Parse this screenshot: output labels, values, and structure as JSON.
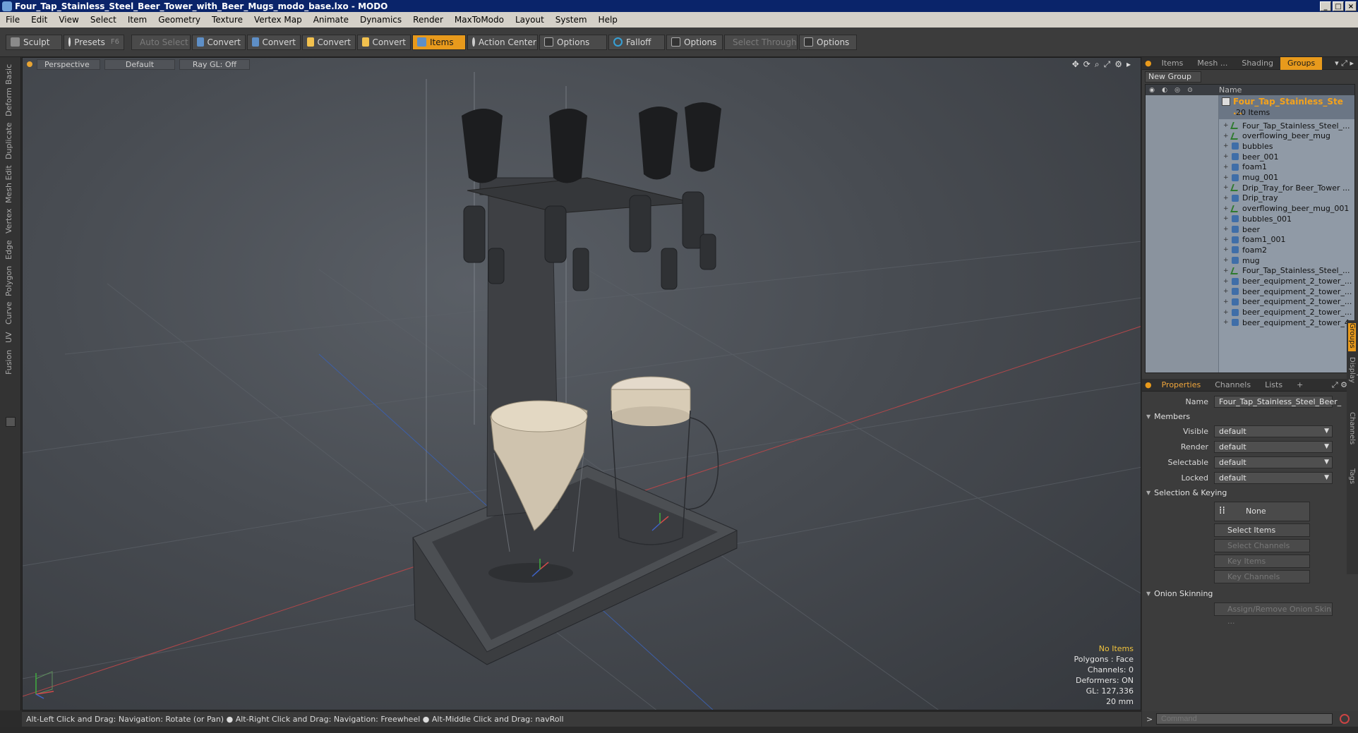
{
  "window": {
    "title": "Four_Tap_Stainless_Steel_Beer_Tower_with_Beer_Mugs_modo_base.lxo - MODO"
  },
  "menu": [
    "File",
    "Edit",
    "View",
    "Select",
    "Item",
    "Geometry",
    "Texture",
    "Vertex Map",
    "Animate",
    "Dynamics",
    "Render",
    "MaxToModo",
    "Layout",
    "System",
    "Help"
  ],
  "toolbar": {
    "sculpt": "Sculpt",
    "presets": "Presets",
    "presets_shortcut": "F6",
    "auto_select": "Auto Select",
    "convert1": "Convert",
    "convert2": "Convert",
    "convert3": "Convert",
    "convert4": "Convert",
    "items": "Items",
    "action_center": "Action Center",
    "options1": "Options",
    "falloff": "Falloff",
    "options2": "Options",
    "select_through": "Select Through",
    "options3": "Options"
  },
  "left_tabs": [
    "Basic",
    "Deform",
    "Duplicate",
    "Mesh Edit",
    "Vertex",
    "Edge",
    "Polygon",
    "Curve",
    "UV",
    "Fusion"
  ],
  "viewport": {
    "view": "Perspective",
    "shading": "Default",
    "raygl": "Ray GL: Off",
    "info": {
      "no_items": "No Items",
      "polygons": "Polygons : Face",
      "channels": "Channels: 0",
      "deformers": "Deformers: ON",
      "gl": "GL: 127,336",
      "scale": "20 mm"
    }
  },
  "status_bar": "Alt-Left Click and Drag: Navigation: Rotate (or Pan) ●  Alt-Right Click and Drag: Navigation: Freewheel ●  Alt-Middle Click and Drag: navRoll",
  "right_panel": {
    "top_tabs": [
      "Items",
      "Mesh ...",
      "Shading",
      "Groups"
    ],
    "new_group": "New Group",
    "name_col": "Name",
    "group": {
      "name": "Four_Tap_Stainless_Ste ...",
      "count": "20 Items"
    },
    "items": [
      {
        "name": "Four_Tap_Stainless_Steel_...",
        "type": "locator"
      },
      {
        "name": "overflowing_beer_mug",
        "type": "locator"
      },
      {
        "name": "bubbles",
        "type": "mesh"
      },
      {
        "name": "beer_001",
        "type": "mesh"
      },
      {
        "name": "foam1",
        "type": "mesh"
      },
      {
        "name": "mug_001",
        "type": "mesh"
      },
      {
        "name": "Drip_Tray_for Beer_Tower ...",
        "type": "locator"
      },
      {
        "name": "Drip_tray",
        "type": "mesh"
      },
      {
        "name": "overflowing_beer_mug_001",
        "type": "locator"
      },
      {
        "name": "bubbles_001",
        "type": "mesh"
      },
      {
        "name": "beer",
        "type": "mesh"
      },
      {
        "name": "foam1_001",
        "type": "mesh"
      },
      {
        "name": "foam2",
        "type": "mesh"
      },
      {
        "name": "mug",
        "type": "mesh"
      },
      {
        "name": "Four_Tap_Stainless_Steel_...",
        "type": "locator"
      },
      {
        "name": "beer_equipment_2_tower_...",
        "type": "mesh"
      },
      {
        "name": "beer_equipment_2_tower_...",
        "type": "mesh"
      },
      {
        "name": "beer_equipment_2_tower_...",
        "type": "mesh"
      },
      {
        "name": "beer_equipment_2_tower_...",
        "type": "mesh"
      },
      {
        "name": "beer_equipment_2_tower_4",
        "type": "mesh"
      }
    ],
    "prop_tabs": [
      "Properties",
      "Channels",
      "Lists",
      "+"
    ],
    "props": {
      "name_label": "Name",
      "name_value": "Four_Tap_Stainless_Steel_Beer_",
      "members": "Members",
      "visible_label": "Visible",
      "visible_value": "default",
      "render_label": "Render",
      "render_value": "default",
      "selectable_label": "Selectable",
      "selectable_value": "default",
      "locked_label": "Locked",
      "locked_value": "default",
      "selection_keying": "Selection & Keying",
      "none": "None",
      "select_items": "Select Items",
      "select_channels": "Select Channels",
      "key_items": "Key Items",
      "key_channels": "Key Channels",
      "onion_skinning": "Onion Skinning",
      "assign_onion": "Assign/Remove Onion Skin ..."
    },
    "side_tabs": [
      "Groups",
      "Group Display",
      "User Channels",
      "Tags"
    ],
    "command_placeholder": "Command"
  }
}
